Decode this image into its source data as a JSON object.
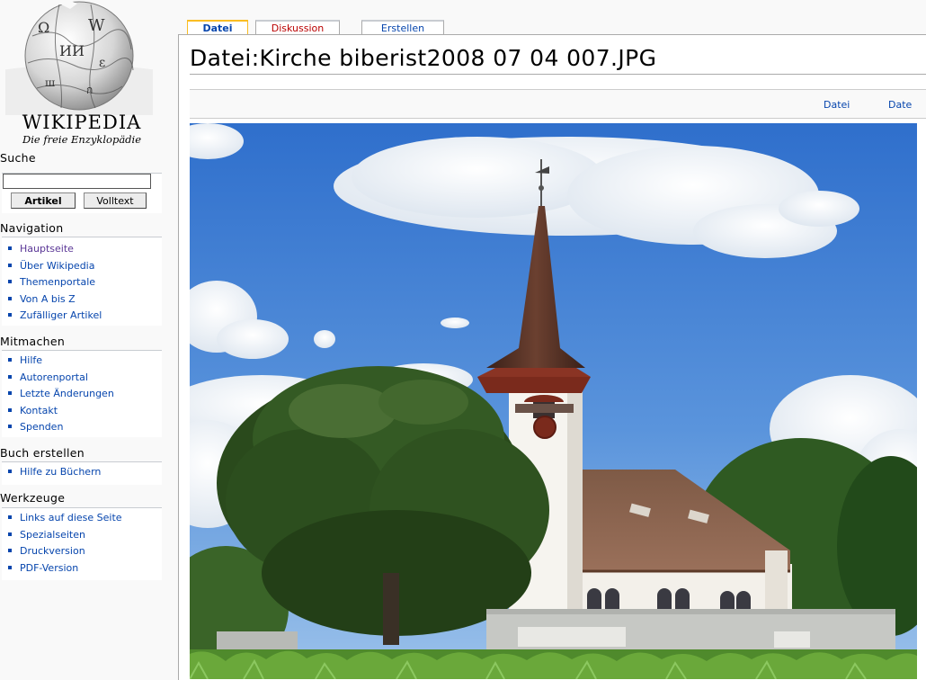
{
  "logo": {
    "wordmark": "WIKIPEDIA",
    "tagline": "Die freie Enzyklopädie"
  },
  "search": {
    "title": "Suche",
    "value": "",
    "buttons": [
      "Artikel",
      "Volltext"
    ]
  },
  "navigation": {
    "title": "Navigation",
    "items": [
      "Hauptseite",
      "Über Wikipedia",
      "Themenportale",
      "Von A bis Z",
      "Zufälliger Artikel"
    ]
  },
  "participate": {
    "title": "Mitmachen",
    "items": [
      "Hilfe",
      "Autorenportal",
      "Letzte Änderungen",
      "Kontakt",
      "Spenden"
    ]
  },
  "book": {
    "title": "Buch erstellen",
    "items": [
      "Hilfe zu Büchern"
    ]
  },
  "tools": {
    "title": "Werkzeuge",
    "items": [
      "Links auf diese Seite",
      "Spezialseiten",
      "Druckversion",
      "PDF-Version"
    ]
  },
  "tabs": [
    "Datei",
    "Diskussion",
    "Erstellen"
  ],
  "page": {
    "title": "Datei:Kirche biberist2008 07 04 007.JPG"
  },
  "filetoc": [
    "Datei",
    "Date"
  ],
  "image": {
    "subject": "church with spire, trees and blue sky"
  },
  "colors": {
    "link": "#0645ad",
    "visited_link": "#5a3696",
    "new_link": "#ba0000",
    "tab_selected_border": "#fabd23"
  }
}
